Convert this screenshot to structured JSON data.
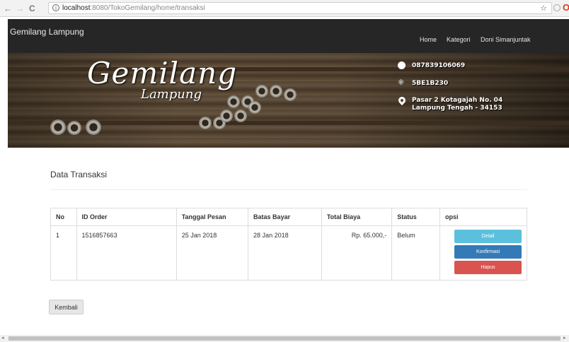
{
  "browser": {
    "back": "←",
    "forward": "→",
    "reload": "C",
    "url_host": "localhost",
    "url_path": ":8080/TokoGemilang/home/transaksi",
    "star": "☆",
    "ext_label": "O"
  },
  "navbar": {
    "brand": "Gemilang Lampung",
    "links": [
      "Home",
      "Kategori",
      "Doni Simanjuntak"
    ]
  },
  "hero": {
    "logo_main": "Gemilang",
    "logo_sub": "Lampung",
    "phone": "087839106069",
    "pin": "5BE1B230",
    "address_line1": "Pasar 2 Kotagajah No. 04",
    "address_line2": "Lampung Tengah - 34153"
  },
  "page": {
    "title": "Data Transaksi"
  },
  "table": {
    "headers": [
      "No",
      "ID Order",
      "Tanggal Pesan",
      "Batas Bayar",
      "Total Biaya",
      "Status",
      "opsi"
    ],
    "rows": [
      {
        "no": "1",
        "id_order": "1516857663",
        "tanggal_pesan": "25 Jan 2018",
        "batas_bayar": "28 Jan 2018",
        "total_biaya": "Rp. 65.000,-",
        "status": "Belum",
        "actions": [
          "Detail",
          "Konfirmasi",
          "Hapus"
        ]
      }
    ]
  },
  "back_button": "Kembali",
  "colors": {
    "navbar_bg": "#262626",
    "detail": "#5bc0de",
    "konfirmasi": "#337ab7",
    "hapus": "#d9534f"
  }
}
